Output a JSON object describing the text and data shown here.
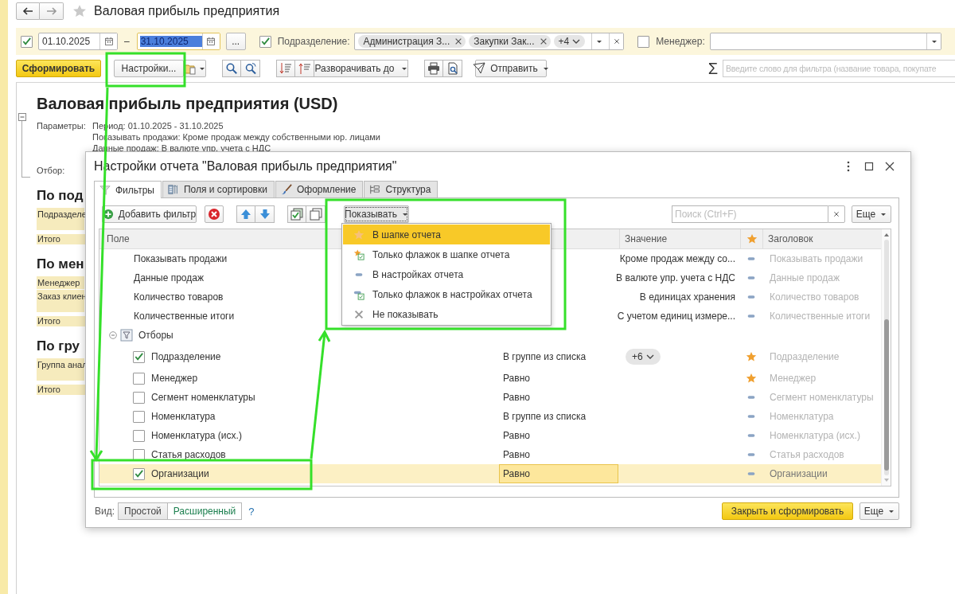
{
  "header": {
    "title": "Валовая прибыль предприятия"
  },
  "filter_bar": {
    "period": {
      "checked": true,
      "start": "01.10.2025",
      "dash": "–",
      "end": "31.10.2025",
      "end_text_selected": true,
      "more": "..."
    },
    "department": {
      "checked": true,
      "label": "Подразделение:",
      "tags": [
        "Администрация З...",
        "Закупки Зак..."
      ],
      "more_count": "+4"
    },
    "manager": {
      "checked": false,
      "label": "Менеджер:"
    }
  },
  "toolbar": {
    "generate": "Сформировать",
    "settings": "Настройки...",
    "expand": "Разворачивать до",
    "send": "Отправить",
    "sum": "Σ",
    "search_placeholder": "Введите слово для фильтра (название товара, покупате"
  },
  "report": {
    "title": "Валовая прибыль предприятия (USD)",
    "params_label": "Параметры:",
    "params": [
      "Период: 01.10.2025 - 31.10.2025",
      "Показывать продажи: Кроме продаж между собственными юр. лицами",
      "Данные продаж: В валюте упр. учета с НДС"
    ],
    "filter_label": "Отбор:",
    "sections": [
      {
        "heading": "По под",
        "header": [
          "Подразделе"
        ],
        "total": "Итого"
      },
      {
        "heading": "По мен",
        "header": [
          "Менеджер",
          "Заказ клиен"
        ],
        "total": "Итого"
      },
      {
        "heading": "По гру",
        "header": [
          "Группа анал"
        ],
        "total": "Итого"
      }
    ]
  },
  "dialog": {
    "title": "Настройки отчета \"Валовая прибыль предприятия\"",
    "tabs": [
      {
        "label": "Фильтры",
        "selected": true
      },
      {
        "label": "Поля и сортировки",
        "selected": false
      },
      {
        "label": "Оформление",
        "selected": false
      },
      {
        "label": "Структура",
        "selected": false
      }
    ],
    "add_filter": "Добавить фильтр",
    "show_button": "Показывать",
    "search_placeholder": "Поиск (Ctrl+F)",
    "more": "Еще",
    "columns": {
      "field": "Поле",
      "value": "Значение",
      "title": "Заголовок"
    },
    "rows": [
      {
        "field": "Показывать продажи",
        "value": "Кроме продаж между со...",
        "kind": "settings",
        "title": "Показывать продажи",
        "selected": false
      },
      {
        "field": "Данные продаж",
        "value": "В валюте упр. учета с НДС",
        "kind": "settings",
        "title": "Данные продаж",
        "selected": false
      },
      {
        "field": "Количество товаров",
        "value": "В единицах хранения",
        "kind": "settings",
        "title": "Количество товаров",
        "selected": false
      },
      {
        "field": "Количественные итоги",
        "value": "С учетом единиц измере...",
        "kind": "settings",
        "title": "Количественные итоги",
        "selected": false
      },
      {
        "field": "Отборы",
        "kind": "group",
        "expanded": true,
        "selected": false,
        "children": [
          {
            "checked": true,
            "field": "Подразделение",
            "condition": "В группе из списка",
            "value_chip": "+6",
            "kind": "header",
            "title": "Подразделение",
            "selected": false
          },
          {
            "checked": false,
            "field": "Менеджер",
            "condition": "Равно",
            "kind": "header",
            "title": "Менеджер",
            "selected": false
          },
          {
            "checked": false,
            "field": "Сегмент номенклатуры",
            "condition": "Равно",
            "kind": "settings",
            "title": "Сегмент номенклатуры",
            "selected": false
          },
          {
            "checked": false,
            "field": "Номенклатура",
            "condition": "В группе из списка",
            "kind": "settings",
            "title": "Номенклатура",
            "selected": false
          },
          {
            "checked": false,
            "field": "Номенклатура (исх.)",
            "condition": "Равно",
            "kind": "settings",
            "title": "Номенклатура (исх.)",
            "selected": false
          },
          {
            "checked": false,
            "field": "Статья расходов",
            "condition": "Равно",
            "kind": "settings",
            "title": "Статья расходов",
            "selected": false
          },
          {
            "checked": true,
            "field": "Организации",
            "condition": "Равно",
            "kind": "settings",
            "title": "Организации",
            "selected": true
          }
        ]
      }
    ],
    "menu": {
      "items": [
        {
          "label": "В шапке отчета",
          "kind": "header",
          "selected": true
        },
        {
          "label": "Только флажок в шапке отчета",
          "kind": "header-flag",
          "selected": false
        },
        {
          "label": "В настройках отчета",
          "kind": "settings",
          "selected": false
        },
        {
          "label": "Только флажок в настройках отчета",
          "kind": "settings-flag",
          "selected": false
        },
        {
          "label": "Не показывать",
          "kind": "hidden",
          "selected": false
        }
      ]
    },
    "view_label": "Вид:",
    "view_modes": [
      {
        "label": "Простой",
        "selected": false
      },
      {
        "label": "Расширенный",
        "selected": true
      }
    ],
    "help": "?",
    "close_generate": "Закрыть и сформировать",
    "footer_more": "Еще"
  }
}
